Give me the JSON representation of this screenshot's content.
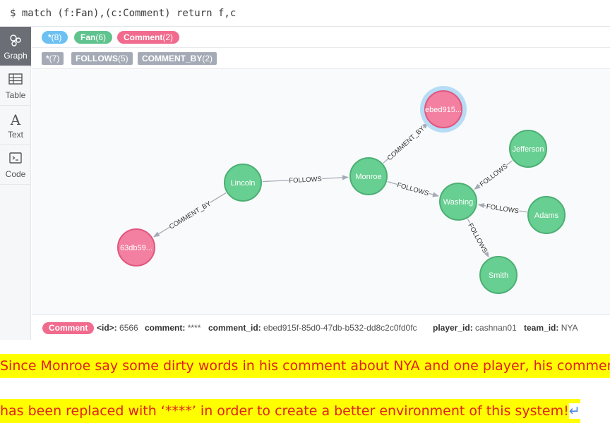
{
  "query": "$ match (f:Fan),(c:Comment) return f,c",
  "sidebar": {
    "items": [
      {
        "label": "Graph",
        "icon": "graph-icon",
        "active": true
      },
      {
        "label": "Table",
        "icon": "table-icon",
        "active": false
      },
      {
        "label": "Text",
        "icon": "text-icon",
        "active": false
      },
      {
        "label": "Code",
        "icon": "code-icon",
        "active": false
      }
    ]
  },
  "node_labels": [
    {
      "name": "*",
      "count": "(8)",
      "color": "#6dc1f2"
    },
    {
      "name": "Fan",
      "count": "(6)",
      "color": "#5fc38d"
    },
    {
      "name": "Comment",
      "count": "(2)",
      "color": "#f16b8e"
    }
  ],
  "rel_types": [
    {
      "name": "*",
      "count": "(7)"
    },
    {
      "name": "FOLLOWS",
      "count": "(5)"
    },
    {
      "name": "COMMENT_BY",
      "count": "(2)"
    }
  ],
  "graph": {
    "colors": {
      "fan": "#68cf92",
      "fan_stroke": "#4caf74",
      "comment": "#f380a0",
      "comment_stroke": "#e0567f",
      "selected_halo": "#b7dcf5",
      "edge": "#a5abb6"
    },
    "nodes": [
      {
        "id": "lincoln",
        "label": "Lincoln",
        "type": "fan"
      },
      {
        "id": "monroe",
        "label": "Monroe",
        "type": "fan"
      },
      {
        "id": "washing",
        "label": "Washing",
        "type": "fan"
      },
      {
        "id": "jefferson",
        "label": "Jefferson",
        "type": "fan"
      },
      {
        "id": "adams",
        "label": "Adams",
        "type": "fan"
      },
      {
        "id": "smith",
        "label": "Smith",
        "type": "fan"
      },
      {
        "id": "c1",
        "label": "ebed915...",
        "type": "comment",
        "selected": true
      },
      {
        "id": "c2",
        "label": "63db59...",
        "type": "comment",
        "selected": false
      }
    ],
    "edges": [
      {
        "from": "lincoln",
        "to": "monroe",
        "label": "FOLLOWS"
      },
      {
        "from": "monroe",
        "to": "washing",
        "label": "FOLLOWS"
      },
      {
        "from": "jefferson",
        "to": "washing",
        "label": "FOLLOWS"
      },
      {
        "from": "adams",
        "to": "washing",
        "label": "FOLLOWS"
      },
      {
        "from": "washing",
        "to": "smith",
        "label": "FOLLOWS"
      },
      {
        "from": "monroe",
        "to": "c1",
        "label": "COMMENT_BY"
      },
      {
        "from": "lincoln",
        "to": "c2",
        "label": "COMMENT_BY"
      }
    ]
  },
  "properties": {
    "label": "Comment",
    "items": [
      {
        "key": "<id>:",
        "value": "6566"
      },
      {
        "key": "comment:",
        "value": "****"
      },
      {
        "key": "comment_id:",
        "value": "ebed915f-85d0-47db-b532-dd8c2c0fd0fc"
      },
      {
        "key": "player_id:",
        "value": "cashnan01"
      },
      {
        "key": "team_id:",
        "value": "NYA"
      }
    ]
  },
  "caption": {
    "line1": "Since Monroe say some dirty words in his comment about NYA and one player, his comment",
    "line2": "has been replaced with ‘****’ in order to create a better environment of this system!",
    "return_mark": "↵"
  }
}
